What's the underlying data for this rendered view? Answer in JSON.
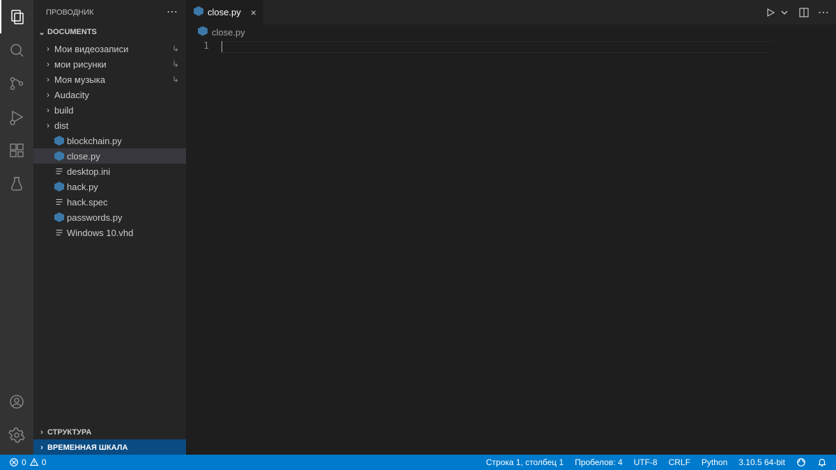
{
  "sidebar": {
    "title": "ПРОВОДНИК",
    "root": "DOCUMENTS",
    "items": [
      {
        "type": "folder",
        "label": "Мои видеозаписи",
        "symlink": true
      },
      {
        "type": "folder",
        "label": "мои рисунки",
        "symlink": true
      },
      {
        "type": "folder",
        "label": "Моя музыка",
        "symlink": true
      },
      {
        "type": "folder",
        "label": "Audacity"
      },
      {
        "type": "folder",
        "label": "build"
      },
      {
        "type": "folder",
        "label": "dist"
      },
      {
        "type": "py",
        "label": "blockchain.py"
      },
      {
        "type": "py",
        "label": "close.py",
        "selected": true
      },
      {
        "type": "txt",
        "label": "desktop.ini"
      },
      {
        "type": "py",
        "label": "hack.py"
      },
      {
        "type": "txt",
        "label": "hack.spec"
      },
      {
        "type": "py",
        "label": "passwords.py"
      },
      {
        "type": "txt",
        "label": "Windows 10.vhd"
      }
    ],
    "panels": {
      "outline": "СТРУКТУРА",
      "timeline": "ВРЕМЕННАЯ ШКАЛА"
    }
  },
  "tab": {
    "label": "close.py"
  },
  "breadcrumb": {
    "file": "close.py"
  },
  "gutter": {
    "line1": "1"
  },
  "status": {
    "errors": "0",
    "warnings": "0",
    "lncol": "Строка 1, столбец 1",
    "indent": "Пробелов: 4",
    "encoding": "UTF-8",
    "eol": "CRLF",
    "lang": "Python",
    "py": "3.10.5 64-bit"
  }
}
